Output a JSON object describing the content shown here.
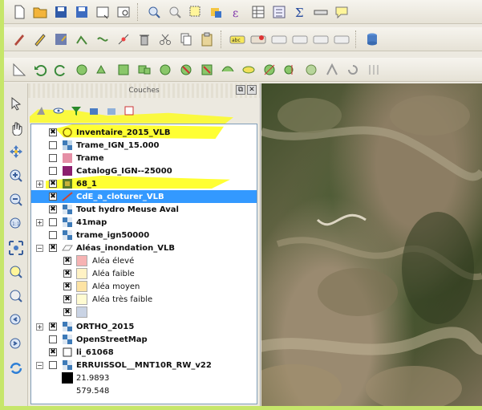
{
  "panel": {
    "title": "Couches",
    "float_button": "⧉",
    "close_button": "✕"
  },
  "layers": [
    {
      "label": "Inventaire_2015_VLB",
      "checked": true,
      "symbol": "outline-yellow"
    },
    {
      "label": "Trame_IGN_15.000",
      "checked": false,
      "symbol": "raster"
    },
    {
      "label": "Trame",
      "checked": false,
      "symbol": "pink"
    },
    {
      "label": "CatalogG_IGN--25000",
      "checked": false,
      "symbol": "purple"
    },
    {
      "label": "68_1",
      "checked": true,
      "symbol": "raster"
    },
    {
      "label": "CdE_a_cloturer_VLB",
      "checked": true,
      "symbol": "line",
      "selected": true
    },
    {
      "label": "Tout hydro Meuse Aval",
      "checked": true,
      "symbol": "raster"
    },
    {
      "label": "41map",
      "checked": false,
      "symbol": "raster"
    },
    {
      "label": "trame_ign50000",
      "checked": false,
      "symbol": "raster"
    },
    {
      "label": "Aléas_inondation_VLB",
      "checked": true,
      "symbol": "group"
    }
  ],
  "legend": [
    {
      "label": "Aléa élevé",
      "color": "#f6b3b3"
    },
    {
      "label": "Aléa faible",
      "color": "#fff2c4"
    },
    {
      "label": "Aléa moyen",
      "color": "#fde3a4"
    },
    {
      "label": "Aléa très faible",
      "color": "#fffbd2"
    },
    {
      "label": "",
      "color": "#c9d3e4"
    }
  ],
  "layers2": [
    {
      "label": "ORTHO_2015",
      "checked": true
    },
    {
      "label": "OpenStreetMap",
      "checked": false
    },
    {
      "label": "li_61068",
      "checked": true
    },
    {
      "label": "ERRUISSOL__MNT10R_RW_v22",
      "checked": false
    }
  ],
  "raster_values": {
    "max": "21.9893",
    "min": "579.548"
  },
  "colors": {
    "accent_yellow": "#ffff00",
    "selection_blue": "#3399ff",
    "frame_green": "#c6e66a"
  }
}
